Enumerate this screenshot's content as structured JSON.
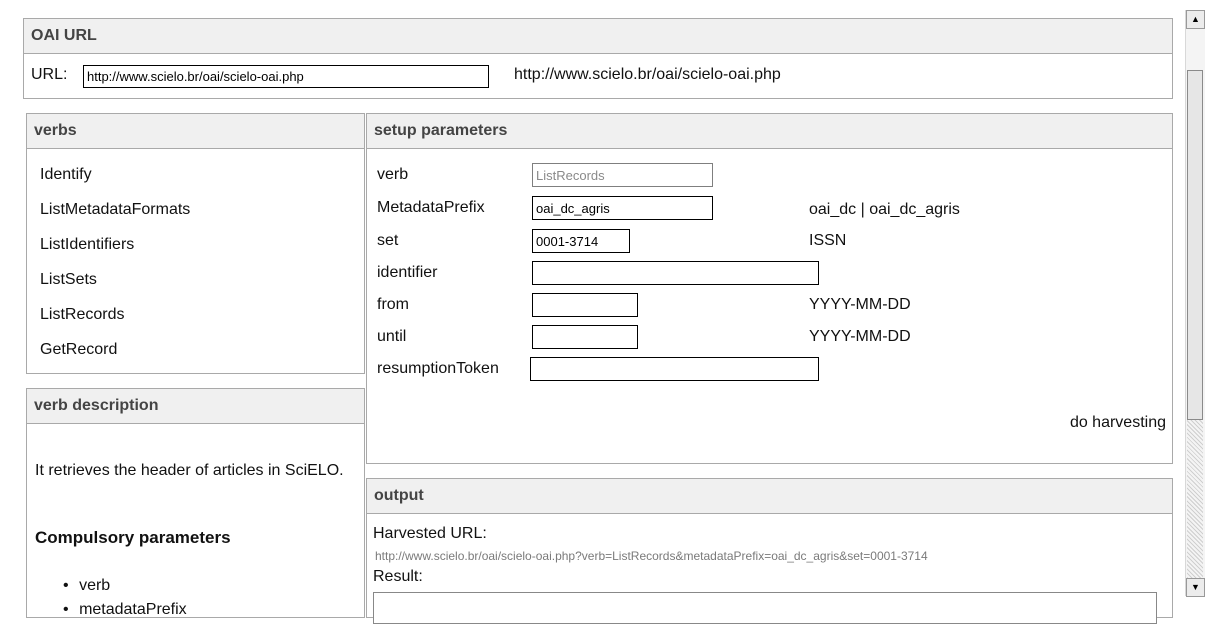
{
  "oai_url": {
    "title": "OAI URL",
    "url_label": "URL:",
    "url_value": "http://www.scielo.br/oai/scielo-oai.php",
    "url_display": "http://www.scielo.br/oai/scielo-oai.php"
  },
  "verbs": {
    "title": "verbs",
    "items": [
      "Identify",
      "ListMetadataFormats",
      "ListIdentifiers",
      "ListSets",
      "ListRecords",
      "GetRecord"
    ]
  },
  "verb_description": {
    "title": "verb description",
    "text": "It retrieves the header of articles in SciELO.",
    "params_heading": "Compulsory parameters",
    "params": [
      "verb",
      "metadataPrefix"
    ]
  },
  "setup": {
    "title": "setup parameters",
    "verb_label": "verb",
    "verb_value": "ListRecords",
    "prefix_label": "MetadataPrefix",
    "prefix_value": "oai_dc_agris",
    "prefix_hint": "oai_dc | oai_dc_agris",
    "set_label": "set",
    "set_value": "0001-3714",
    "set_hint": "ISSN",
    "identifier_label": "identifier",
    "identifier_value": "",
    "from_label": "from",
    "from_value": "",
    "from_hint": "YYYY-MM-DD",
    "until_label": "until",
    "until_value": "",
    "until_hint": "YYYY-MM-DD",
    "token_label": "resumptionToken",
    "token_value": "",
    "do_harvesting": "do harvesting"
  },
  "output": {
    "title": "output",
    "harvested_label": "Harvested URL:",
    "harvested_url": "http://www.scielo.br/oai/scielo-oai.php?verb=ListRecords&metadataPrefix=oai_dc_agris&set=0001-3714",
    "result_label": "Result:"
  },
  "scrollbar": {
    "up_icon": "▲",
    "down_icon": "▼"
  }
}
